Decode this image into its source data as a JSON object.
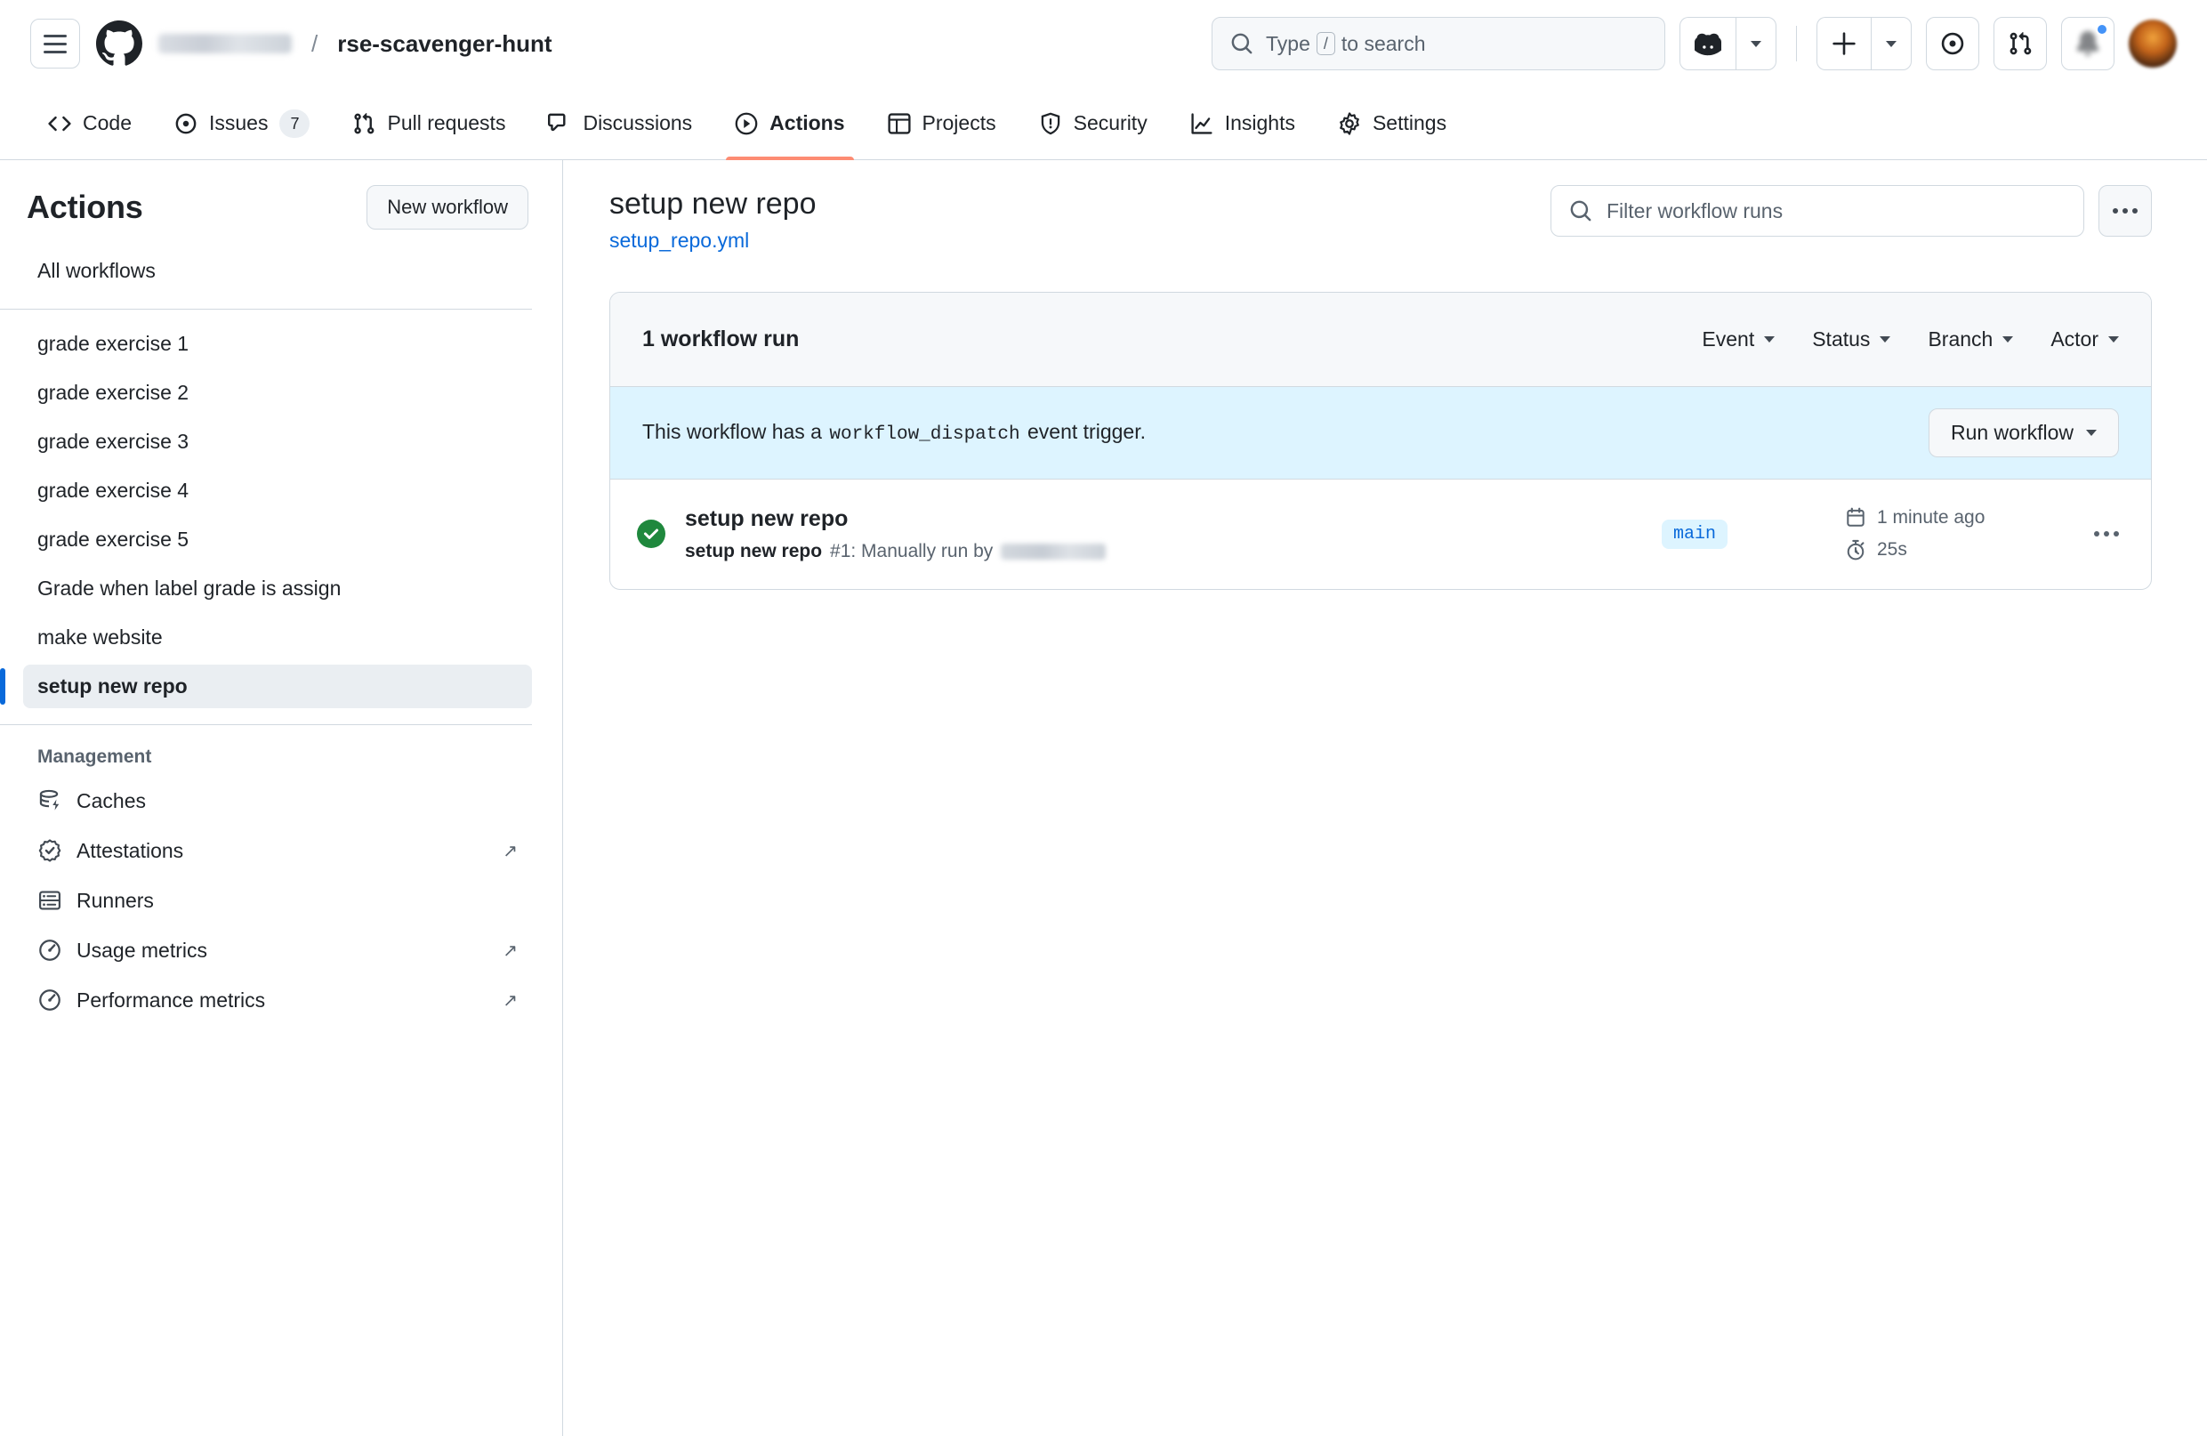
{
  "header": {
    "menu_icon": "hamburger-icon",
    "logo_icon": "github-logo-icon",
    "owner": "",
    "separator": "/",
    "repo": "rse-scavenger-hunt",
    "search_placeholder_pre": "Type",
    "search_key": "/",
    "search_placeholder_post": "to search",
    "copilot_icon": "copilot-icon",
    "create_icon": "plus-icon",
    "issues_icon": "issue-opened-icon",
    "pullrequests_icon": "git-pull-request-icon",
    "notifications_icon": "bell-icon",
    "avatar_icon": "user-avatar"
  },
  "repo_nav": {
    "tabs": [
      {
        "label": "Code",
        "icon": "code-icon",
        "active": false,
        "count": ""
      },
      {
        "label": "Issues",
        "icon": "issue-opened-icon",
        "active": false,
        "count": "7"
      },
      {
        "label": "Pull requests",
        "icon": "git-pull-request-icon",
        "active": false,
        "count": ""
      },
      {
        "label": "Discussions",
        "icon": "comment-discussion-icon",
        "active": false,
        "count": ""
      },
      {
        "label": "Actions",
        "icon": "play-circle-icon",
        "active": true,
        "count": ""
      },
      {
        "label": "Projects",
        "icon": "project-table-icon",
        "active": false,
        "count": ""
      },
      {
        "label": "Security",
        "icon": "shield-icon",
        "active": false,
        "count": ""
      },
      {
        "label": "Insights",
        "icon": "graph-icon",
        "active": false,
        "count": ""
      },
      {
        "label": "Settings",
        "icon": "gear-icon",
        "active": false,
        "count": ""
      }
    ]
  },
  "sidebar": {
    "title": "Actions",
    "new_workflow_label": "New workflow",
    "all_workflows_label": "All workflows",
    "workflows": [
      {
        "label": "grade exercise 1",
        "selected": false
      },
      {
        "label": "grade exercise 2",
        "selected": false
      },
      {
        "label": "grade exercise 3",
        "selected": false
      },
      {
        "label": "grade exercise 4",
        "selected": false
      },
      {
        "label": "grade exercise 5",
        "selected": false
      },
      {
        "label": "Grade when label grade is assign",
        "selected": false
      },
      {
        "label": "make website",
        "selected": false
      },
      {
        "label": "setup new repo",
        "selected": true
      }
    ],
    "management_label": "Management",
    "management": [
      {
        "label": "Caches",
        "icon": "cache-database-icon",
        "external": false
      },
      {
        "label": "Attestations",
        "icon": "verified-badge-icon",
        "external": true
      },
      {
        "label": "Runners",
        "icon": "server-icon",
        "external": false
      },
      {
        "label": "Usage metrics",
        "icon": "meter-icon",
        "external": true
      },
      {
        "label": "Performance metrics",
        "icon": "meter-icon",
        "external": true
      }
    ],
    "external_glyph": "↗"
  },
  "main": {
    "title": "setup new repo",
    "workflow_file": "setup_repo.yml",
    "filter_placeholder": "Filter workflow runs",
    "filter_icon": "search-icon",
    "overflow_icon": "kebab-horizontal-icon"
  },
  "runs": {
    "count_label": "1 workflow run",
    "filters": [
      {
        "label": "Event"
      },
      {
        "label": "Status"
      },
      {
        "label": "Branch"
      },
      {
        "label": "Actor"
      }
    ],
    "banner": {
      "text_before": "This workflow has a",
      "code": "workflow_dispatch",
      "text_after": "event trigger.",
      "button_label": "Run workflow"
    },
    "items": [
      {
        "status_icon": "check-circle-fill-icon",
        "status_color": "#1f883d",
        "title": "setup new repo",
        "subtitle_workflow": "setup new repo",
        "subtitle_rest": "#1: Manually run by",
        "actor": "",
        "branch": "main",
        "branch_color": "#0969da",
        "branch_bg": "#ddf4ff",
        "time_icon": "calendar-icon",
        "time": "1 minute ago",
        "duration_icon": "stopwatch-icon",
        "duration": "25s",
        "overflow_icon": "kebab-horizontal-icon"
      }
    ]
  },
  "colors": {
    "accent": "#0969da",
    "active_underline": "#fd8c73",
    "success": "#1f883d",
    "banner_bg": "#ddf4ff",
    "muted_bg": "#f6f8fa",
    "border": "#d1d9e0",
    "text_muted": "#59636e"
  }
}
